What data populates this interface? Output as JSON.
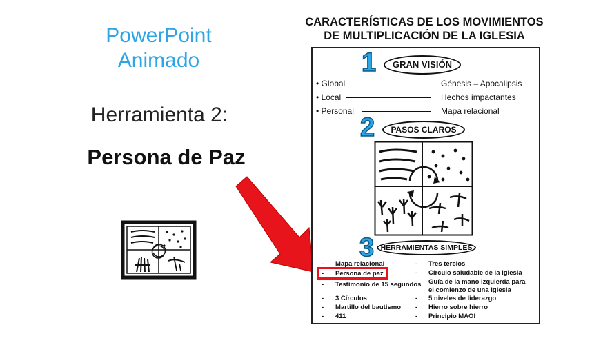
{
  "left_panel": {
    "title_line1": "PowerPoint",
    "title_line2": "Animado",
    "tool_number": "Herramienta 2:",
    "tool_name": "Persona de Paz"
  },
  "document": {
    "title_line1": "CARACTERÍSTICAS DE LOS MOVIMIENTOS",
    "title_line2": "DE MULTIPLICACIÓN DE LA IGLESIA",
    "section1": {
      "number": "1",
      "heading": "GRAN VISIÓN",
      "rows": [
        {
          "left": "• Global",
          "right": "Génesis – Apocalipsis"
        },
        {
          "left": "• Local",
          "right": "Hechos impactantes"
        },
        {
          "left": "• Personal",
          "right": "Mapa relacional"
        }
      ]
    },
    "section2": {
      "number": "2",
      "heading": "PASOS CLAROS"
    },
    "section3": {
      "number": "3",
      "heading": "HERRAMIENTAS SIMPLES",
      "left_tools": [
        "Mapa relacional",
        "Persona de paz",
        "Testimonio de 15 segundos",
        "3 Círculos",
        "Martillo del bautismo",
        "411"
      ],
      "right_tools": [
        "Tres tercios",
        "Círculo saludable de la iglesia",
        "Guía de la mano izquierda para el comienzo de una iglesia",
        "5 niveles de liderazgo",
        "Hierro sobre hierro",
        "Principio MAOI"
      ]
    }
  },
  "colors": {
    "accent_blue": "#2ea6e6",
    "highlight_red": "#e8141b",
    "arrow_red": "#e8141b"
  }
}
